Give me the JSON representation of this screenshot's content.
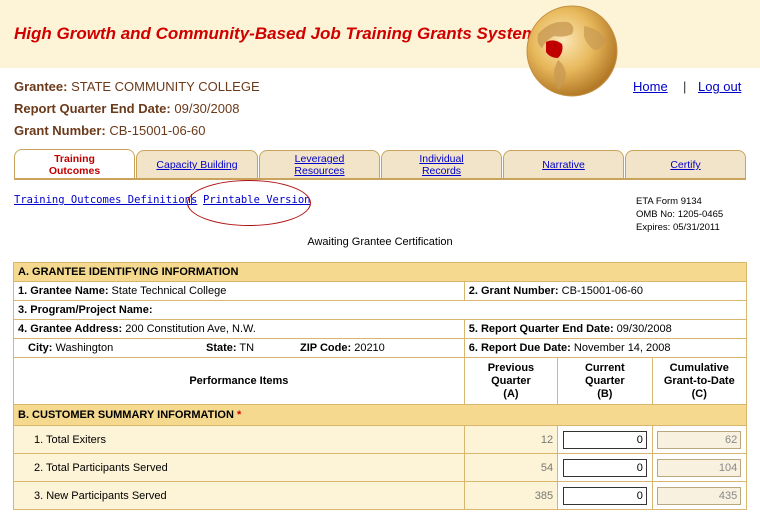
{
  "app": {
    "title": "High Growth and Community-Based Job Training Grants System"
  },
  "header": {
    "grantee_label": "Grantee:",
    "grantee_value": "STATE COMMUNITY COLLEGE",
    "quarter_label": "Report Quarter End Date:",
    "quarter_value": "09/30/2008",
    "grant_label": "Grant Number:",
    "grant_value": "CB-15001-06-60",
    "home": "Home",
    "separator": "|",
    "logout": "Log out"
  },
  "tabs": [
    {
      "label": "Training Outcomes",
      "line1": "Training",
      "line2": "Outcomes"
    },
    {
      "label": "Capacity Building",
      "line1": "Capacity Building",
      "line2": ""
    },
    {
      "label": "Leveraged Resources",
      "line1": "Leveraged",
      "line2": "Resources"
    },
    {
      "label": "Individual Records",
      "line1": "Individual",
      "line2": "Records"
    },
    {
      "label": "Narrative",
      "line1": "Narrative",
      "line2": ""
    },
    {
      "label": "Certify",
      "line1": "Certify",
      "line2": ""
    }
  ],
  "subnav": {
    "definitions": "Training Outcomes Definitions",
    "separator": "|",
    "printable": "Printable Version"
  },
  "eta": {
    "form": "ETA Form 9134",
    "omb": "OMB No:  1205-0465",
    "expires": "Expires:  05/31/2011"
  },
  "status": "Awaiting Grantee Certification",
  "section_a": {
    "title": "A. GRANTEE IDENTIFYING INFORMATION",
    "grantee_name_label": "1. Grantee Name:",
    "grantee_name": "State Technical College",
    "grant_number_label": "2. Grant Number:",
    "grant_number": "CB-15001-06-60",
    "program_label": "3. Program/Project Name:",
    "address_label": "4. Grantee Address:",
    "address": "200 Constitution Ave, N.W.",
    "quarter_end_label": "5. Report Quarter End Date:",
    "quarter_end": "09/30/2008",
    "city_label": "City:",
    "city": "Washington",
    "state_label": "State:",
    "state": "TN",
    "zip_label": "ZIP Code:",
    "zip": "20210",
    "due_label": "6. Report Due Date:",
    "due": "November 14, 2008"
  },
  "columns": {
    "items": "Performance Items",
    "prev_1": "Previous",
    "prev_2": "Quarter",
    "prev_3": "(A)",
    "curr_1": "Current",
    "curr_2": "Quarter",
    "curr_3": "(B)",
    "cum_1": "Cumulative",
    "cum_2": "Grant-to-Date",
    "cum_3": "(C)"
  },
  "section_b": {
    "title": "B. CUSTOMER SUMMARY INFORMATION",
    "required_mark": "*",
    "rows": [
      {
        "label": "1. Total Exiters",
        "previous": "12",
        "current": "0",
        "cumulative": "62"
      },
      {
        "label": "2. Total Participants Served",
        "previous": "54",
        "current": "0",
        "cumulative": "104"
      },
      {
        "label": "3. New Participants Served",
        "previous": "385",
        "current": "0",
        "cumulative": "435"
      }
    ]
  },
  "colors": {
    "title_red": "#d00000",
    "tab_bg": "#f2e4c8",
    "section_bg": "#f5d98e",
    "cell_bg": "#fdf3d6"
  }
}
